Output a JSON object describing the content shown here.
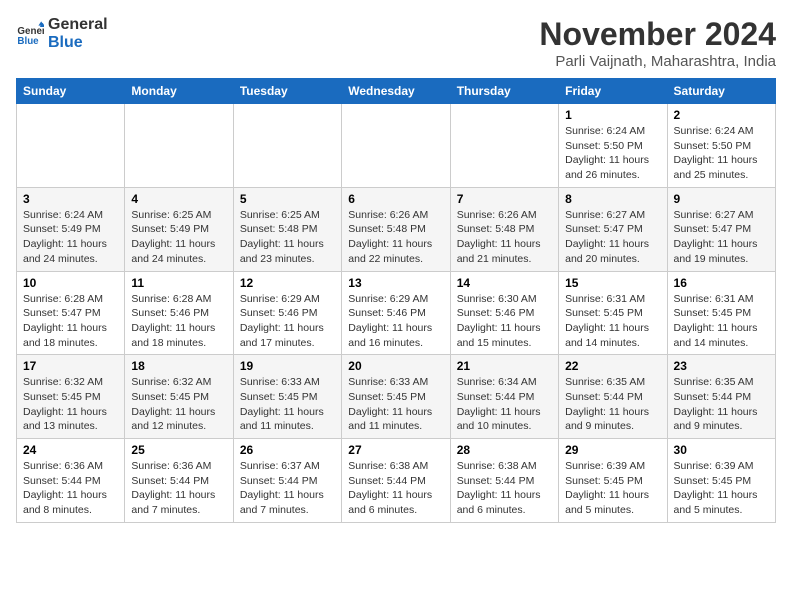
{
  "logo": {
    "line1": "General",
    "line2": "Blue"
  },
  "title": "November 2024",
  "location": "Parli Vaijnath, Maharashtra, India",
  "header_days": [
    "Sunday",
    "Monday",
    "Tuesday",
    "Wednesday",
    "Thursday",
    "Friday",
    "Saturday"
  ],
  "weeks": [
    [
      {
        "day": "",
        "info": ""
      },
      {
        "day": "",
        "info": ""
      },
      {
        "day": "",
        "info": ""
      },
      {
        "day": "",
        "info": ""
      },
      {
        "day": "",
        "info": ""
      },
      {
        "day": "1",
        "info": "Sunrise: 6:24 AM\nSunset: 5:50 PM\nDaylight: 11 hours and 26 minutes."
      },
      {
        "day": "2",
        "info": "Sunrise: 6:24 AM\nSunset: 5:50 PM\nDaylight: 11 hours and 25 minutes."
      }
    ],
    [
      {
        "day": "3",
        "info": "Sunrise: 6:24 AM\nSunset: 5:49 PM\nDaylight: 11 hours and 24 minutes."
      },
      {
        "day": "4",
        "info": "Sunrise: 6:25 AM\nSunset: 5:49 PM\nDaylight: 11 hours and 24 minutes."
      },
      {
        "day": "5",
        "info": "Sunrise: 6:25 AM\nSunset: 5:48 PM\nDaylight: 11 hours and 23 minutes."
      },
      {
        "day": "6",
        "info": "Sunrise: 6:26 AM\nSunset: 5:48 PM\nDaylight: 11 hours and 22 minutes."
      },
      {
        "day": "7",
        "info": "Sunrise: 6:26 AM\nSunset: 5:48 PM\nDaylight: 11 hours and 21 minutes."
      },
      {
        "day": "8",
        "info": "Sunrise: 6:27 AM\nSunset: 5:47 PM\nDaylight: 11 hours and 20 minutes."
      },
      {
        "day": "9",
        "info": "Sunrise: 6:27 AM\nSunset: 5:47 PM\nDaylight: 11 hours and 19 minutes."
      }
    ],
    [
      {
        "day": "10",
        "info": "Sunrise: 6:28 AM\nSunset: 5:47 PM\nDaylight: 11 hours and 18 minutes."
      },
      {
        "day": "11",
        "info": "Sunrise: 6:28 AM\nSunset: 5:46 PM\nDaylight: 11 hours and 18 minutes."
      },
      {
        "day": "12",
        "info": "Sunrise: 6:29 AM\nSunset: 5:46 PM\nDaylight: 11 hours and 17 minutes."
      },
      {
        "day": "13",
        "info": "Sunrise: 6:29 AM\nSunset: 5:46 PM\nDaylight: 11 hours and 16 minutes."
      },
      {
        "day": "14",
        "info": "Sunrise: 6:30 AM\nSunset: 5:46 PM\nDaylight: 11 hours and 15 minutes."
      },
      {
        "day": "15",
        "info": "Sunrise: 6:31 AM\nSunset: 5:45 PM\nDaylight: 11 hours and 14 minutes."
      },
      {
        "day": "16",
        "info": "Sunrise: 6:31 AM\nSunset: 5:45 PM\nDaylight: 11 hours and 14 minutes."
      }
    ],
    [
      {
        "day": "17",
        "info": "Sunrise: 6:32 AM\nSunset: 5:45 PM\nDaylight: 11 hours and 13 minutes."
      },
      {
        "day": "18",
        "info": "Sunrise: 6:32 AM\nSunset: 5:45 PM\nDaylight: 11 hours and 12 minutes."
      },
      {
        "day": "19",
        "info": "Sunrise: 6:33 AM\nSunset: 5:45 PM\nDaylight: 11 hours and 11 minutes."
      },
      {
        "day": "20",
        "info": "Sunrise: 6:33 AM\nSunset: 5:45 PM\nDaylight: 11 hours and 11 minutes."
      },
      {
        "day": "21",
        "info": "Sunrise: 6:34 AM\nSunset: 5:44 PM\nDaylight: 11 hours and 10 minutes."
      },
      {
        "day": "22",
        "info": "Sunrise: 6:35 AM\nSunset: 5:44 PM\nDaylight: 11 hours and 9 minutes."
      },
      {
        "day": "23",
        "info": "Sunrise: 6:35 AM\nSunset: 5:44 PM\nDaylight: 11 hours and 9 minutes."
      }
    ],
    [
      {
        "day": "24",
        "info": "Sunrise: 6:36 AM\nSunset: 5:44 PM\nDaylight: 11 hours and 8 minutes."
      },
      {
        "day": "25",
        "info": "Sunrise: 6:36 AM\nSunset: 5:44 PM\nDaylight: 11 hours and 7 minutes."
      },
      {
        "day": "26",
        "info": "Sunrise: 6:37 AM\nSunset: 5:44 PM\nDaylight: 11 hours and 7 minutes."
      },
      {
        "day": "27",
        "info": "Sunrise: 6:38 AM\nSunset: 5:44 PM\nDaylight: 11 hours and 6 minutes."
      },
      {
        "day": "28",
        "info": "Sunrise: 6:38 AM\nSunset: 5:44 PM\nDaylight: 11 hours and 6 minutes."
      },
      {
        "day": "29",
        "info": "Sunrise: 6:39 AM\nSunset: 5:45 PM\nDaylight: 11 hours and 5 minutes."
      },
      {
        "day": "30",
        "info": "Sunrise: 6:39 AM\nSunset: 5:45 PM\nDaylight: 11 hours and 5 minutes."
      }
    ]
  ]
}
